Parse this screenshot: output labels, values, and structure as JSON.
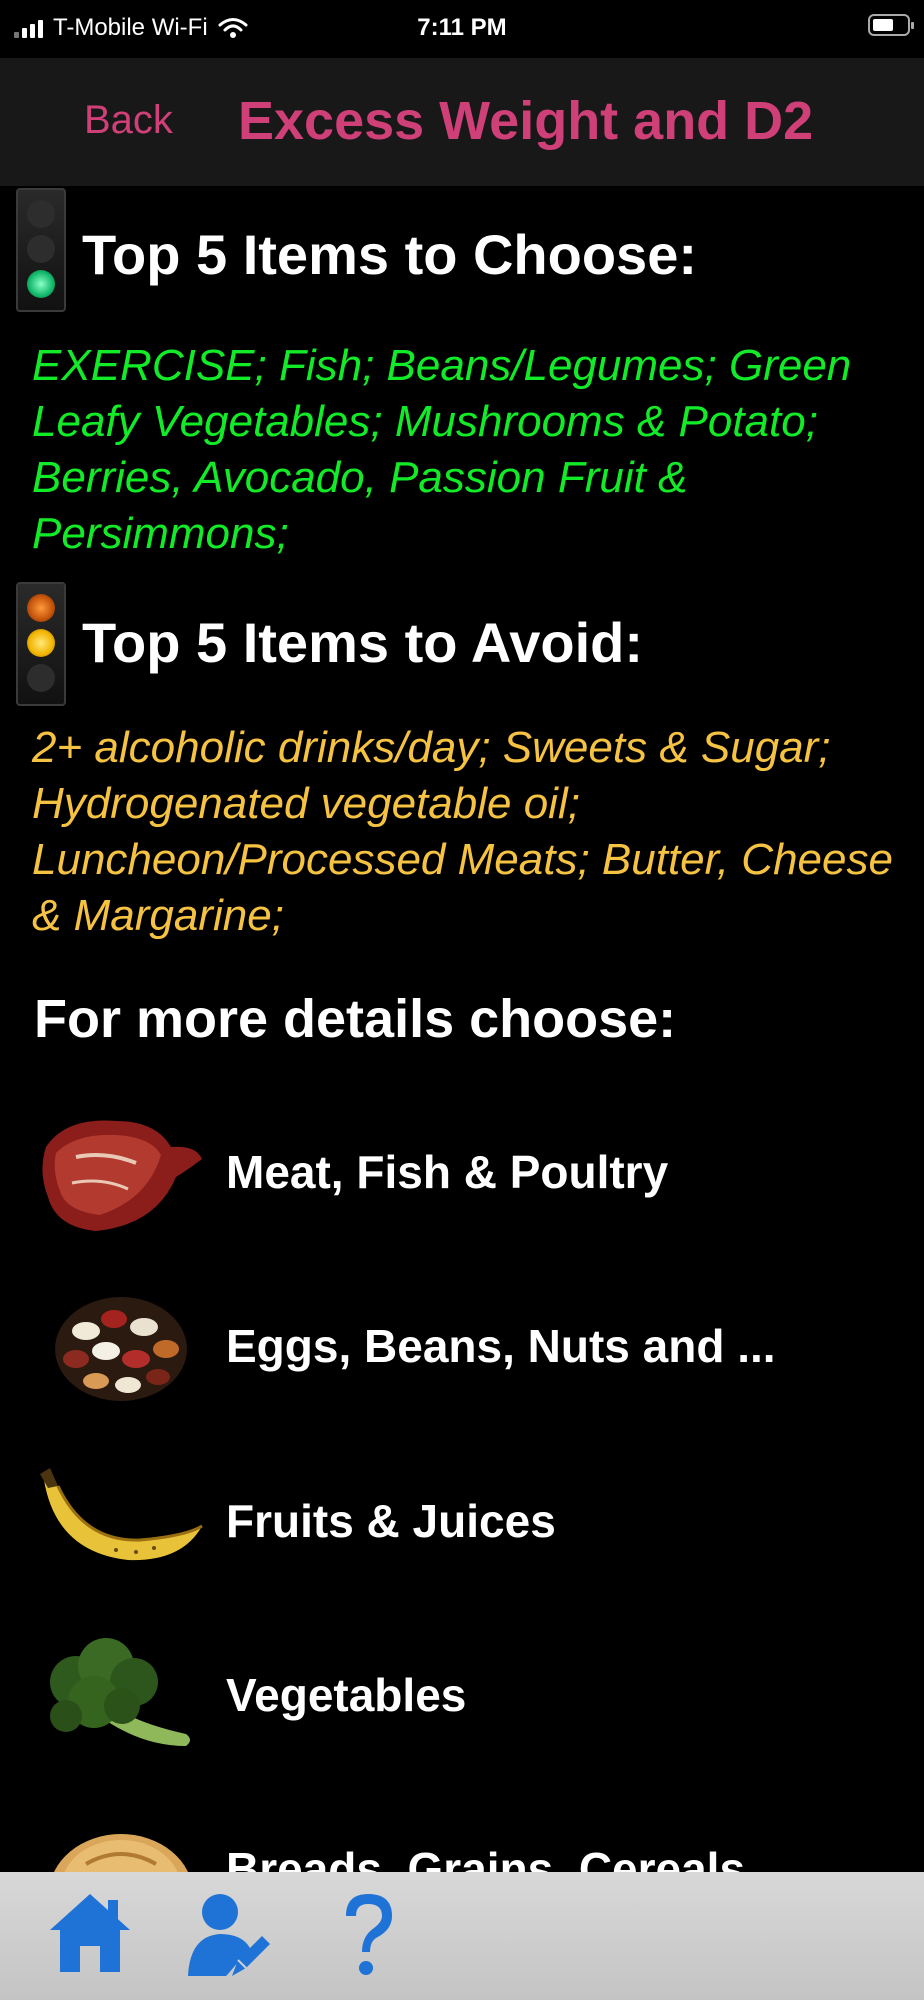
{
  "status_bar": {
    "carrier": "T-Mobile Wi-Fi",
    "time": "7:11 PM"
  },
  "nav": {
    "back_label": "Back",
    "title": "Excess Weight and D2"
  },
  "choose": {
    "heading": "Top 5 Items to Choose:",
    "text": "EXERCISE; Fish; Beans/Legumes; Green Leafy Vegetables; Mushrooms & Potato; Berries, Avocado, Passion Fruit & Persimmons;",
    "color": "#12ec28"
  },
  "avoid": {
    "heading": "Top 5 Items to Avoid:",
    "text": "2+ alcoholic drinks/day; Sweets & Sugar; Hydrogenated vegetable oil; Luncheon/Processed Meats; Butter, Cheese & Margarine;",
    "color": "#f5c242"
  },
  "details": {
    "heading": "For more details choose:",
    "categories": [
      {
        "label": "Meat, Fish & Poultry",
        "icon": "steak-icon"
      },
      {
        "label": "Eggs, Beans, Nuts and ...",
        "icon": "beans-icon"
      },
      {
        "label": "Fruits & Juices",
        "icon": "banana-icon"
      },
      {
        "label": "Vegetables",
        "icon": "broccoli-icon"
      },
      {
        "label": "Breads, Grains, Cereals",
        "icon": "bread-icon"
      }
    ]
  },
  "tab_bar": {
    "items": [
      {
        "icon": "home-icon"
      },
      {
        "icon": "profile-edit-icon"
      },
      {
        "icon": "help-icon"
      }
    ],
    "accent": "#1f73d6"
  }
}
